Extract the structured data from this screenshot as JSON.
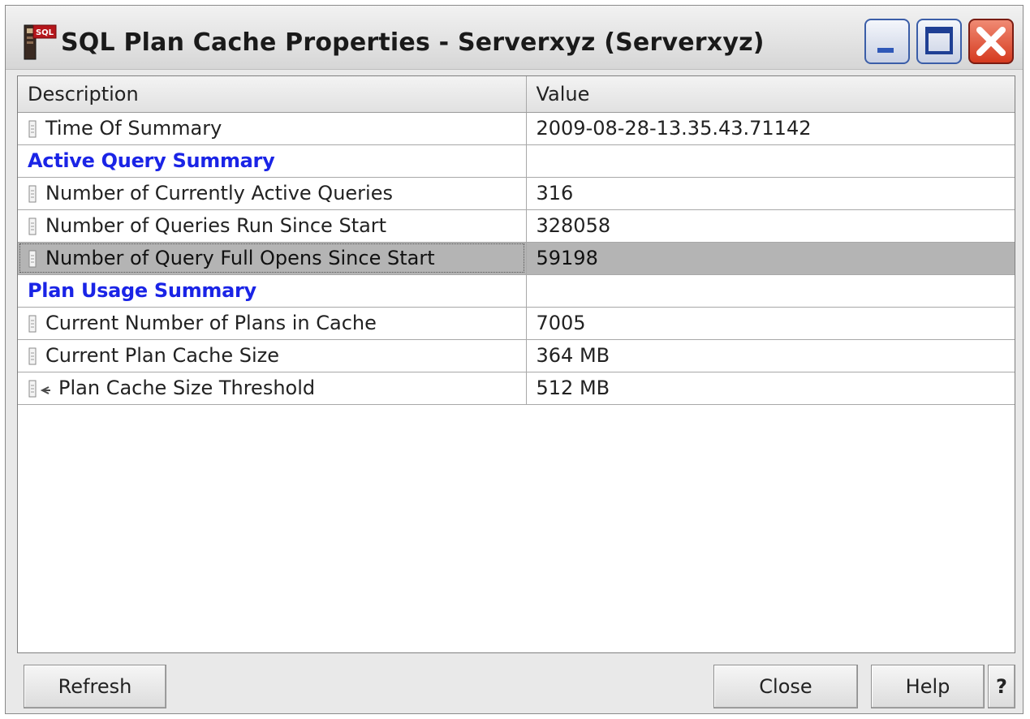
{
  "window": {
    "title": "SQL Plan Cache Properties - Serverxyz (Serverxyz)",
    "app_icon_label": "SQL"
  },
  "table": {
    "columns": [
      "Description",
      "Value"
    ],
    "rows": [
      {
        "description": "Time Of Summary",
        "value": "2009-08-28-13.35.43.71142",
        "kind": "item",
        "icon": "property-icon"
      },
      {
        "description": "Active Query Summary",
        "value": "",
        "kind": "section"
      },
      {
        "description": "Number of Currently Active Queries",
        "value": "316",
        "kind": "item",
        "icon": "property-icon"
      },
      {
        "description": "Number of Queries Run Since Start",
        "value": "328058",
        "kind": "item",
        "icon": "property-icon"
      },
      {
        "description": "Number of Query Full Opens Since Start",
        "value": "59198",
        "kind": "item",
        "icon": "property-icon",
        "selected": true
      },
      {
        "description": "Plan Usage Summary",
        "value": "",
        "kind": "section"
      },
      {
        "description": "Current Number of Plans in Cache",
        "value": "7005",
        "kind": "item",
        "icon": "property-icon"
      },
      {
        "description": "Current Plan Cache Size",
        "value": "364 MB",
        "kind": "item",
        "icon": "property-icon"
      },
      {
        "description": "Plan Cache Size Threshold",
        "value": "512 MB",
        "kind": "item",
        "icon": "editable-property-icon"
      }
    ]
  },
  "buttons": {
    "refresh": "Refresh",
    "close": "Close",
    "help": "Help",
    "context_help": "?"
  },
  "colors": {
    "section_text": "#1a24e6",
    "selected_row": "#b4b4b4"
  }
}
